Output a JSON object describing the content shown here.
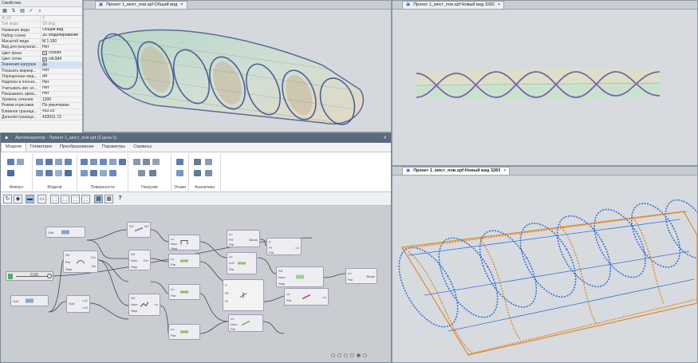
{
  "properties": {
    "title": "Свойства",
    "toolbar": [
      "grid-icon",
      "sort-icon",
      "filter-icon",
      "check-icon",
      "search-icon"
    ],
    "rows": [
      {
        "key": "M_ID",
        "value": "2",
        "dim": true
      },
      {
        "key": "Тип вида",
        "value": "3D вид",
        "dim": true
      },
      {
        "key": "Название вида",
        "value": "Общий вид"
      },
      {
        "key": "Набор слоев",
        "value": "3D Моделирование"
      },
      {
        "key": "Масштаб вида",
        "value": "М 1:100"
      },
      {
        "key": "Вид для результат...",
        "value": "Нет"
      },
      {
        "key": "Цвет фона",
        "value": "ccd0d5",
        "swatch": "#ccd0d5"
      },
      {
        "key": "Цвет сетки",
        "value": "c4c3d4",
        "swatch": "#c4c3d4"
      },
      {
        "key": "Значения нагрузок",
        "value": "Да",
        "selected": true
      },
      {
        "key": "Показать маркир...",
        "value": "Нет"
      },
      {
        "key": "Упрощенные мод...",
        "value": "Да"
      },
      {
        "key": "Надписи в плоско...",
        "value": "Нет"
      },
      {
        "key": "Учитывать вес эл...",
        "value": "Нет"
      },
      {
        "key": "Показывать арма...",
        "value": "Нет"
      },
      {
        "key": "Уровень сечения",
        "value": "1200"
      },
      {
        "key": "Режим отрисовки",
        "value": "По умолчанию"
      },
      {
        "key": "Ближняя граница...",
        "value": "433.03"
      },
      {
        "key": "Дальняя граница...",
        "value": "433031.72"
      }
    ]
  },
  "viewports": {
    "main": {
      "tab": "Проект 1_мост_пов.spf:Общий вид",
      "close": "×"
    },
    "right_top": {
      "tab": "Проект 1_мост_пов.spf:Новый вид 3282",
      "close": "×"
    },
    "right_bottom": {
      "tab": "Проект 1_мост_пов.spf:Новый вид 3283",
      "close": "×"
    }
  },
  "autogenerator": {
    "title": "Автогенератор - Проект 1_мост_пов.spf (Сцена 1)",
    "close": "✕",
    "tabs": [
      "Модели",
      "Геометрия",
      "Преобразование",
      "Параметры",
      "Сервисы"
    ],
    "groups": [
      "Импорт",
      "Модели",
      "Поверхности",
      "Нагрузки",
      "Этажи",
      "Аналитика"
    ],
    "help": "?",
    "slider_value": "0.90",
    "nodes": [
      {
        "id": "n1",
        "title": "Surf",
        "in": [
          "Surf"
        ],
        "out": []
      },
      {
        "id": "n2",
        "title": "Srf",
        "in": [
          "Srf",
          "Pts",
          "Step"
        ],
        "out": [
          "Crv",
          "Srf"
        ]
      },
      {
        "id": "n3",
        "title": "Srf",
        "in": [
          "Srf",
          "Num",
          "Step"
        ],
        "out": [
          "Srf",
          "Crv"
        ]
      },
      {
        "id": "n4",
        "title": "Ln",
        "in": [
          "Ln",
          "Num",
          "Step"
        ],
        "out": [
          "Ln"
        ]
      },
      {
        "id": "n5",
        "title": "Ln",
        "in": [
          "Ln",
          "Prt",
          "Par"
        ],
        "out": [
          "Beam"
        ]
      },
      {
        "id": "n6",
        "title": "P",
        "in": [
          "P",
          "Pt",
          "Par"
        ],
        "out": [
          "Ln"
        ]
      },
      {
        "id": "n7",
        "title": "Fit",
        "in": [
          "Fit"
        ],
        "out": []
      },
      {
        "id": "n8",
        "title": "Surf",
        "in": [
          "Surf"
        ],
        "out": []
      },
      {
        "id": "n9",
        "title": "Surf",
        "in": [
          "Surf"
        ],
        "out": [
          "Ln1",
          "Ln2"
        ]
      },
      {
        "id": "n10",
        "title": "Srf",
        "in": [
          "Srf",
          "Num",
          "Step"
        ],
        "out": [
          "Ln"
        ]
      }
    ]
  }
}
